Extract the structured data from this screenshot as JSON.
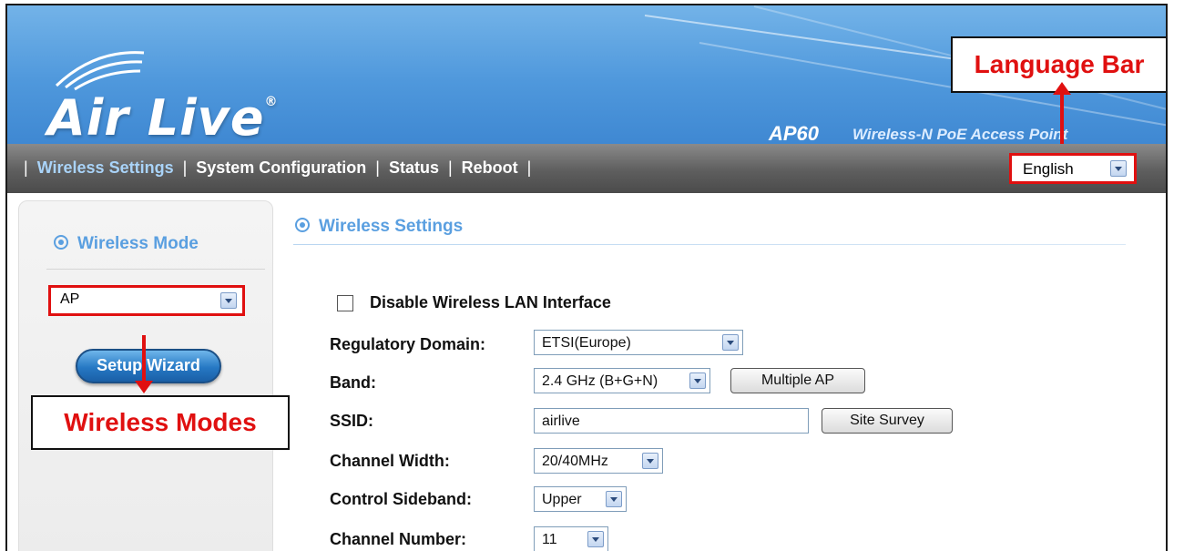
{
  "branding": {
    "logo": "Air Live",
    "trademark": "®",
    "model": "AP60",
    "model_desc": "Wireless-N PoE Access Point"
  },
  "nav": {
    "items": [
      {
        "label": "Wireless Settings",
        "active": true
      },
      {
        "label": "System Configuration",
        "active": false
      },
      {
        "label": "Status",
        "active": false
      },
      {
        "label": "Reboot",
        "active": false
      }
    ],
    "separator": "|",
    "language": "English"
  },
  "sidebar": {
    "title": "Wireless Mode",
    "mode_value": "AP",
    "wizard_label": "Setup Wizard"
  },
  "main": {
    "title": "Wireless Settings",
    "disable_label": "Disable Wireless LAN Interface",
    "fields": {
      "regulatory_domain": {
        "label": "Regulatory Domain:",
        "value": "ETSI(Europe)"
      },
      "band": {
        "label": "Band:",
        "value": "2.4 GHz (B+G+N)",
        "button": "Multiple AP"
      },
      "ssid": {
        "label": "SSID:",
        "value": "airlive",
        "button": "Site Survey"
      },
      "channel_width": {
        "label": "Channel Width:",
        "value": "20/40MHz"
      },
      "control_sideband": {
        "label": "Control Sideband:",
        "value": "Upper"
      },
      "channel_number": {
        "label": "Channel Number:",
        "value": "11"
      }
    }
  },
  "annotations": {
    "language_bar": "Language Bar",
    "wireless_modes": "Wireless Modes"
  },
  "colors": {
    "accent": "#5a9fe0",
    "highlight": "#e01010",
    "banner": "#4f98dc",
    "navbar": "#5e5e5e"
  }
}
